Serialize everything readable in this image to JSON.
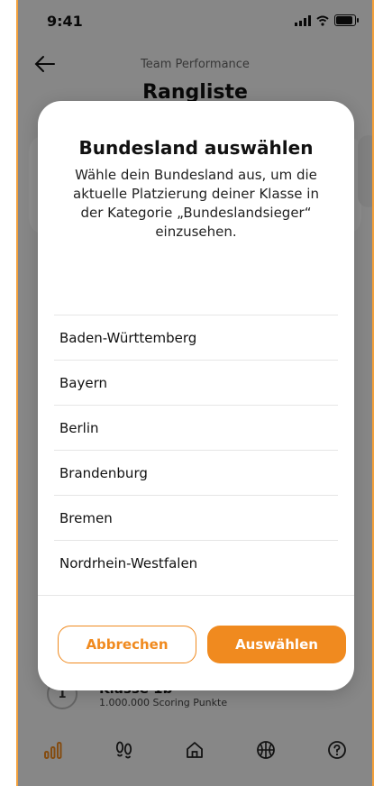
{
  "status": {
    "time": "9:41"
  },
  "header": {
    "subtitle": "Team Performance",
    "title": "Rangliste"
  },
  "background": {
    "rank": "1",
    "class_name": "Klasse 1b",
    "points": "1.000.000 Scoring Punkte"
  },
  "modal": {
    "title": "Bundesland auswählen",
    "description": "Wähle dein Bundesland aus, um die aktuelle Platzierung deiner Klasse in der Kategorie „Bundeslandsieger“ einzusehen.",
    "states": [
      "Baden-Württemberg",
      "Bayern",
      "Berlin",
      "Brandenburg",
      "Bremen",
      "Nordrhein-Westfalen"
    ],
    "cancel_label": "Abbrechen",
    "select_label": "Auswählen"
  },
  "tabs": [
    {
      "icon": "chart-icon"
    },
    {
      "icon": "footprints-icon"
    },
    {
      "icon": "home-icon"
    },
    {
      "icon": "basketball-icon"
    },
    {
      "icon": "help-icon"
    }
  ],
  "colors": {
    "accent": "#f08a1f"
  }
}
